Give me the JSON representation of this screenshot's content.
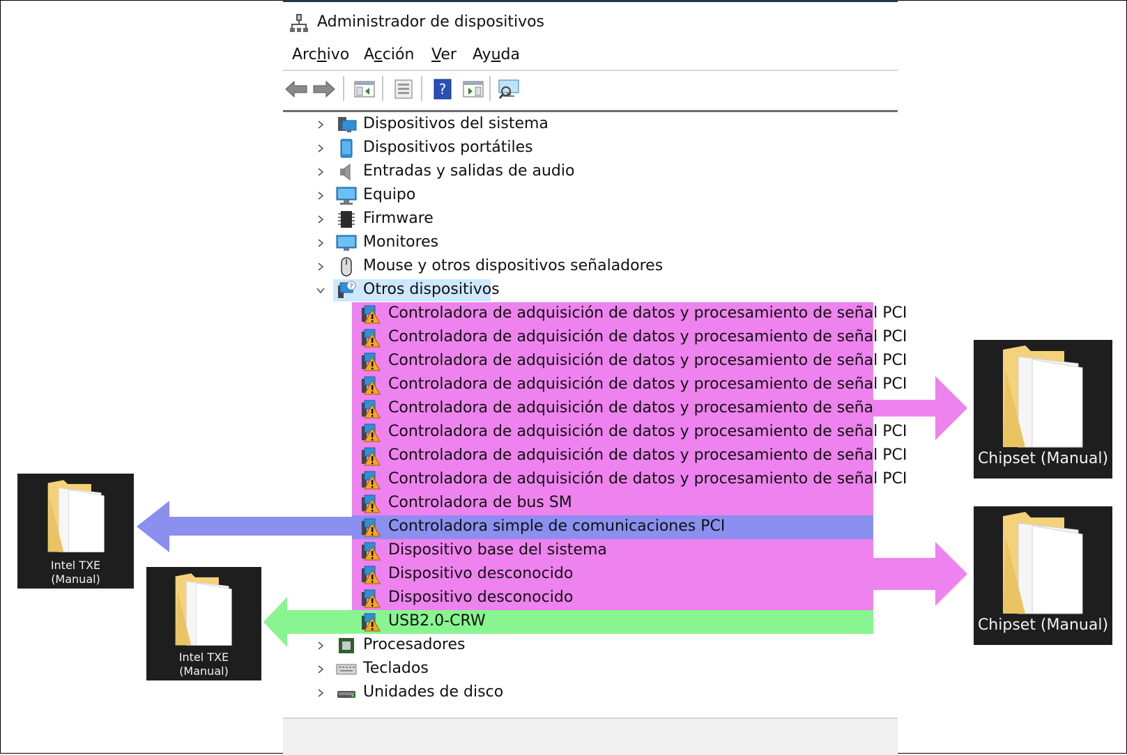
{
  "window": {
    "title": "Administrador de dispositivos",
    "title_icon": "device-manager-icon"
  },
  "menu": {
    "items": [
      {
        "before": "Arc",
        "ul": "h",
        "after": "ivo"
      },
      {
        "before": "A",
        "ul": "c",
        "after": "ción"
      },
      {
        "before": "",
        "ul": "V",
        "after": "er"
      },
      {
        "before": "Ay",
        "ul": "u",
        "after": "da"
      }
    ]
  },
  "toolbar": {
    "buttons": [
      "back-arrow-icon",
      "forward-arrow-icon",
      "show-hide-console-tree-icon",
      "properties-icon",
      "help-icon",
      "action-pane-icon",
      "scan-hardware-icon"
    ]
  },
  "tree": {
    "categories_before": [
      {
        "label": "Dispositivos del sistema",
        "icon": "system-devices-icon"
      },
      {
        "label": "Dispositivos portátiles",
        "icon": "portable-devices-icon"
      },
      {
        "label": "Entradas y salidas de audio",
        "icon": "speaker-icon"
      },
      {
        "label": "Equipo",
        "icon": "computer-icon"
      },
      {
        "label": "Firmware",
        "icon": "firmware-chip-icon"
      },
      {
        "label": "Monitores",
        "icon": "monitor-icon"
      },
      {
        "label": "Mouse y otros dispositivos señaladores",
        "icon": "mouse-icon"
      }
    ],
    "expanded": {
      "label": "Otros dispositivos",
      "icon": "other-devices-icon"
    },
    "children": [
      {
        "label": "Controladora de adquisición de datos y procesamiento de señal PCI",
        "highlight": "#ee82ee"
      },
      {
        "label": "Controladora de adquisición de datos y procesamiento de señal PCI",
        "highlight": "#ee82ee"
      },
      {
        "label": "Controladora de adquisición de datos y procesamiento de señal PCI",
        "highlight": "#ee82ee"
      },
      {
        "label": "Controladora de adquisición de datos y procesamiento de señal PCI",
        "highlight": "#ee82ee"
      },
      {
        "label": "Controladora de adquisición de datos y procesamiento de señal PCI",
        "highlight": "#ee82ee"
      },
      {
        "label": "Controladora de adquisición de datos y procesamiento de señal PCI",
        "highlight": "#ee82ee"
      },
      {
        "label": "Controladora de adquisición de datos y procesamiento de señal PCI",
        "highlight": "#ee82ee"
      },
      {
        "label": "Controladora de adquisición de datos y procesamiento de señal PCI",
        "highlight": "#ee82ee"
      },
      {
        "label": "Controladora de bus SM",
        "highlight": "#ee82ee"
      },
      {
        "label": "Controladora simple de comunicaciones PCI",
        "highlight": "#8a8ff0"
      },
      {
        "label": "Dispositivo base del sistema",
        "highlight": "#ee82ee"
      },
      {
        "label": "Dispositivo desconocido",
        "highlight": "#ee82ee"
      },
      {
        "label": "Dispositivo desconocido",
        "highlight": "#ee82ee"
      },
      {
        "label": "USB2.0-CRW",
        "highlight": "#88f590"
      }
    ],
    "categories_after": [
      {
        "label": "Procesadores",
        "icon": "processor-icon"
      },
      {
        "label": "Teclados",
        "icon": "keyboard-icon"
      },
      {
        "label": "Unidades de disco",
        "icon": "disk-drive-icon"
      }
    ]
  },
  "folders": {
    "chipset_top": {
      "caption": "Chipset (Manual)"
    },
    "chipset_bottom": {
      "caption": "Chipset (Manual)"
    },
    "intel_txe_left": {
      "line1": "Intel TXE",
      "line2": "(Manual)"
    },
    "intel_txe_mid": {
      "line1": "Intel TXE",
      "line2": "(Manual)"
    }
  },
  "colors": {
    "pink": "#ee82ee",
    "blue": "#8a8ff0",
    "green": "#88f590",
    "selection": "#cde8ff"
  }
}
